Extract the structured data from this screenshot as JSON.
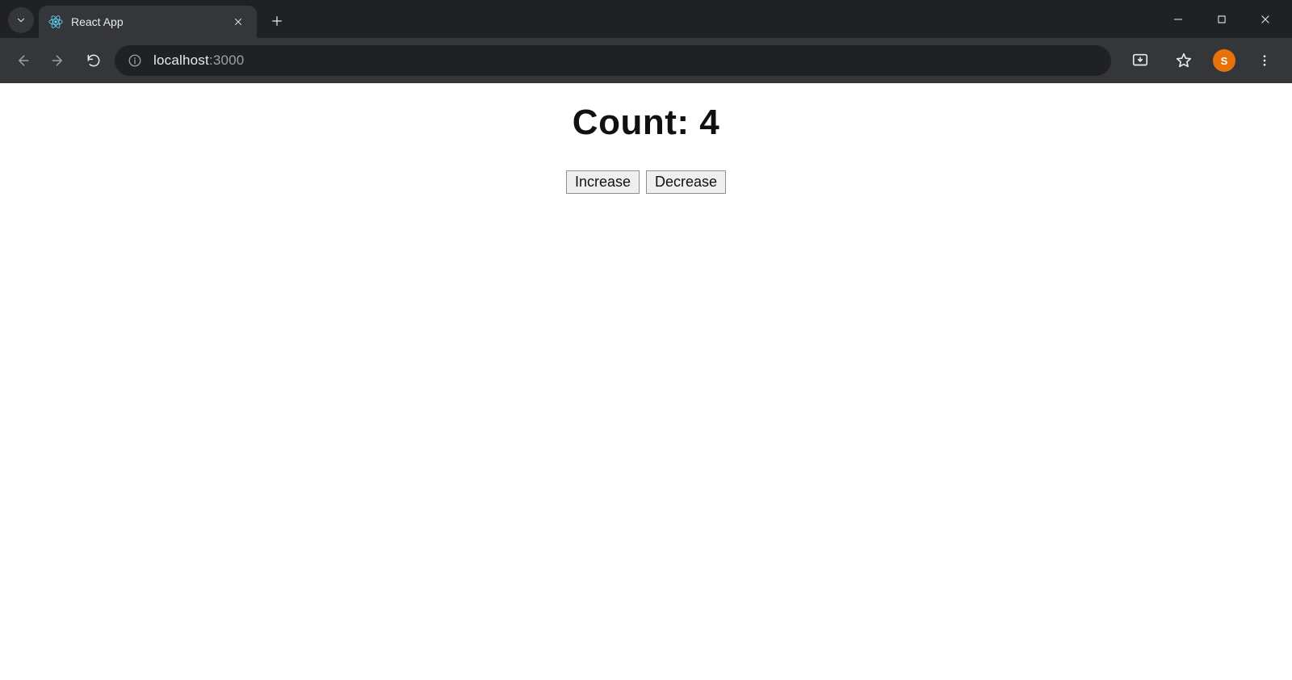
{
  "browser": {
    "tab_title": "React App",
    "url_host": "localhost",
    "url_rest": ":3000",
    "avatar_letter": "S"
  },
  "page": {
    "heading": "Count: 4",
    "increase_label": "Increase",
    "decrease_label": "Decrease"
  }
}
